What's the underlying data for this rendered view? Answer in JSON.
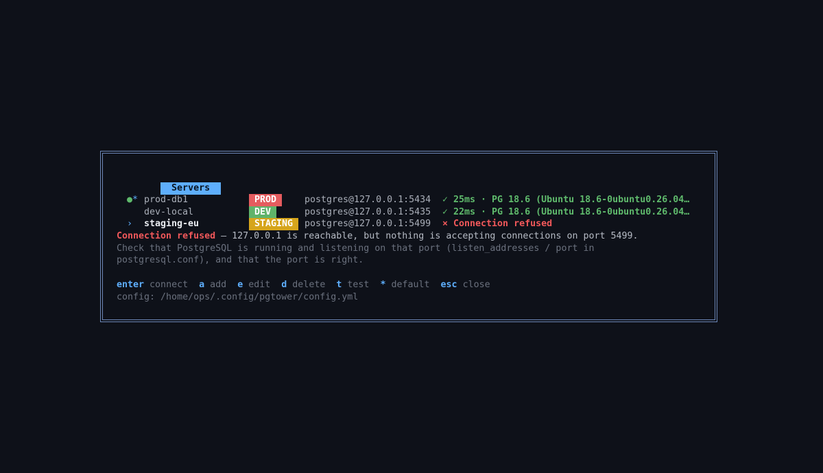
{
  "panel": {
    "title": "Servers"
  },
  "servers": [
    {
      "dot": "●",
      "star": "*",
      "cursor": "",
      "name": "prod-db1",
      "tag": "PROD",
      "address": "postgres@127.0.0.1:5434",
      "status": "✓ 25ms · PG 18.6 (Ubuntu 18.6-0ubuntu0.26.04…",
      "status_kind": "ok"
    },
    {
      "dot": "",
      "star": "",
      "cursor": "",
      "name": "dev-local",
      "tag": "DEV",
      "address": "postgres@127.0.0.1:5435",
      "status": "✓ 22ms · PG 18.6 (Ubuntu 18.6-0ubuntu0.26.04…",
      "status_kind": "ok"
    },
    {
      "dot": "",
      "star": "",
      "cursor": "›",
      "name": "staging-eu",
      "tag": "STAGING",
      "address": "postgres@127.0.0.1:5499",
      "status": "× Connection refused",
      "status_kind": "error"
    }
  ],
  "error": {
    "title": "Connection refused",
    "message": " — 127.0.0.1 is reachable, but nothing is accepting connections on port 5499.",
    "hint_line1": "Check that PostgreSQL is running and listening on that port (listen_addresses / port in",
    "hint_line2": "postgresql.conf), and that the port is right."
  },
  "shortcuts": [
    {
      "key": "enter",
      "label": "connect"
    },
    {
      "key": "a",
      "label": "add"
    },
    {
      "key": "e",
      "label": "edit"
    },
    {
      "key": "d",
      "label": "delete"
    },
    {
      "key": "t",
      "label": "test"
    },
    {
      "key": "*",
      "label": "default"
    },
    {
      "key": "esc",
      "label": "close"
    }
  ],
  "config": {
    "label": "config: ",
    "path": "/home/ops/.config/pgtower/config.yml"
  },
  "colors": {
    "background": "#0e1119",
    "accent": "#5eaefc",
    "ok": "#5fba6c",
    "error": "#f0585a",
    "prod_tag": "#e55c5f",
    "dev_tag": "#5fb36a",
    "staging_tag": "#d6a51c"
  }
}
